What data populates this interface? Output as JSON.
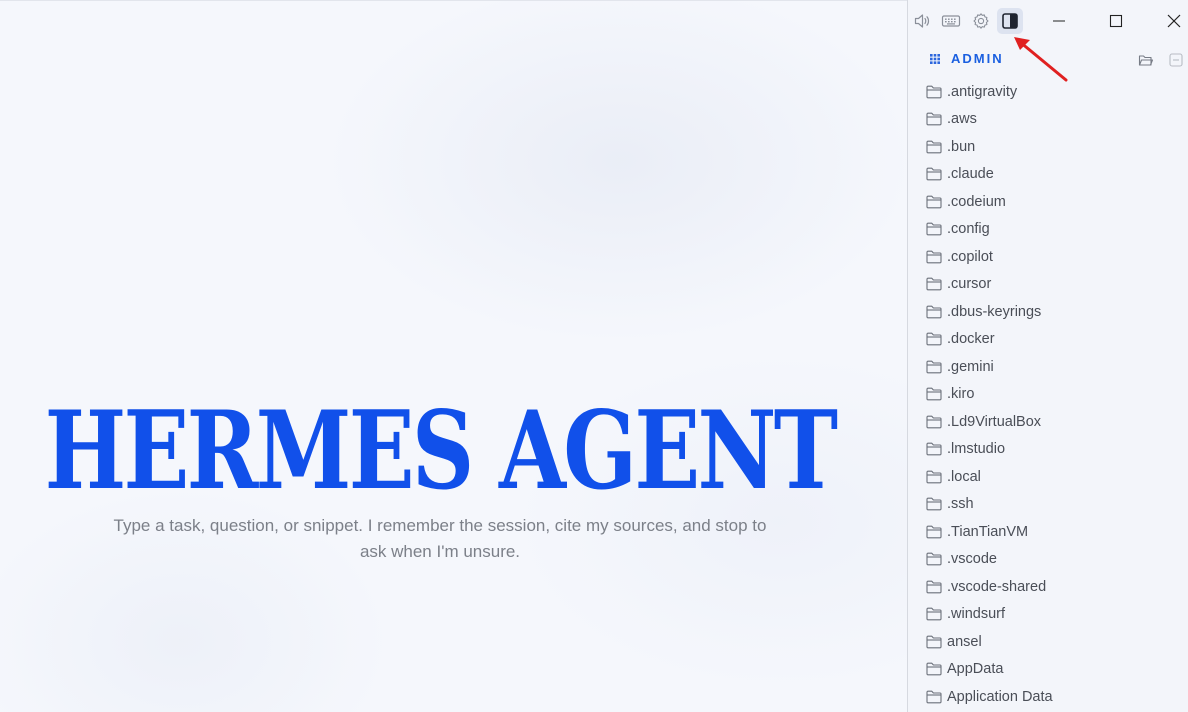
{
  "hero": {
    "title": "HERMES AGENT",
    "subtitle": "Type a task, question, or snippet. I remember the session, cite my sources, and stop to ask when I'm unsure."
  },
  "toolbar": {
    "icons": [
      "speaker-icon",
      "keyboard-icon",
      "gear-icon",
      "panel-toggle-icon"
    ],
    "window_controls": [
      "minimize-icon",
      "maximize-icon",
      "close-icon"
    ]
  },
  "explorer": {
    "section_title": "ADMIN",
    "items": [
      ".antigravity",
      ".aws",
      ".bun",
      ".claude",
      ".codeium",
      ".config",
      ".copilot",
      ".cursor",
      ".dbus-keyrings",
      ".docker",
      ".gemini",
      ".kiro",
      ".Ld9VirtualBox",
      ".lmstudio",
      ".local",
      ".ssh",
      ".TianTianVM",
      ".vscode",
      ".vscode-shared",
      ".windsurf",
      "ansel",
      "AppData",
      "Application Data"
    ]
  },
  "colors": {
    "accent": "#1150ea",
    "annotation_arrow": "#e02020"
  }
}
